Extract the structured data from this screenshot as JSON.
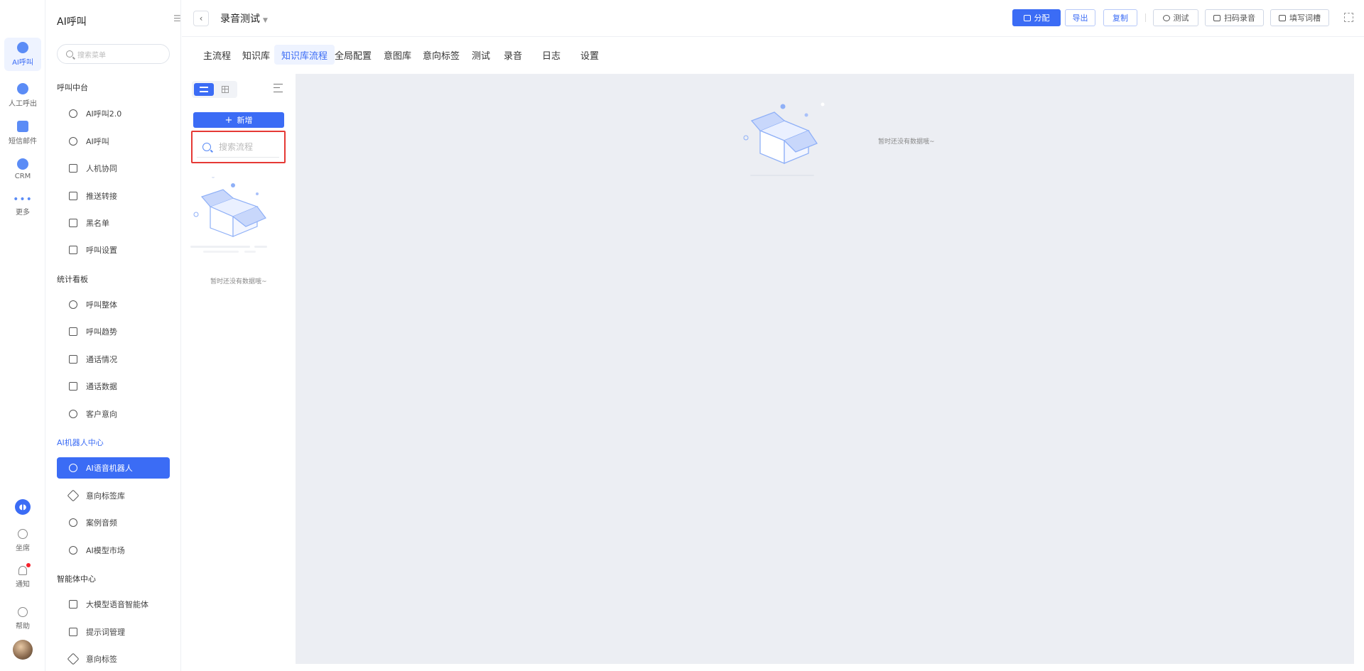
{
  "rail": {
    "items": [
      {
        "label": "AI呼叫",
        "icon": "ai-call-icon"
      },
      {
        "label": "人工呼出",
        "icon": "manual-call-icon"
      },
      {
        "label": "短信邮件",
        "icon": "sms-mail-icon"
      },
      {
        "label": "CRM",
        "icon": "crm-icon"
      },
      {
        "label": "更多",
        "icon": "more-icon"
      }
    ],
    "bottom": [
      {
        "label": "坐席",
        "icon": "headset-icon"
      },
      {
        "label": "通知",
        "icon": "bell-icon"
      },
      {
        "label": "帮助",
        "icon": "help-icon"
      }
    ]
  },
  "nav": {
    "title": "AI呼叫",
    "search_placeholder": "搜索菜单",
    "groups": [
      {
        "title": "呼叫中台",
        "items": [
          "AI呼叫2.0",
          "AI呼叫",
          "人机协同",
          "推送转接",
          "黑名单",
          "呼叫设置"
        ]
      },
      {
        "title": "统计看板",
        "items": [
          "呼叫整体",
          "呼叫趋势",
          "通话情况",
          "通话数据",
          "客户意向"
        ]
      },
      {
        "title": "AI机器人中心",
        "items": [
          "AI语音机器人",
          "意向标签库",
          "案例音频",
          "AI模型市场"
        ]
      },
      {
        "title": "智能体中心",
        "items": [
          "大模型语音智能体",
          "提示词管理",
          "意向标签"
        ]
      }
    ]
  },
  "topbar": {
    "title": "录音测试",
    "buttons": {
      "assign": "分配",
      "export": "导出",
      "copy": "复制",
      "test": "测试",
      "scan_record": "扫码录音",
      "write_script": "填写词槽"
    }
  },
  "tabs": [
    "主流程",
    "知识库",
    "知识库流程",
    "全局配置",
    "意图库",
    "意向标签",
    "测试",
    "录音",
    "日志",
    "设置"
  ],
  "active_tab": "知识库流程",
  "flow_panel": {
    "add_label": "新增",
    "search_placeholder": "搜索流程",
    "empty_text": "暂时还没有数据哦~"
  },
  "canvas": {
    "empty_text": "暂时还没有数据哦~"
  },
  "colors": {
    "primary": "#3b6cf5",
    "highlight_border": "#e53935",
    "canvas_bg": "#eceef3"
  }
}
